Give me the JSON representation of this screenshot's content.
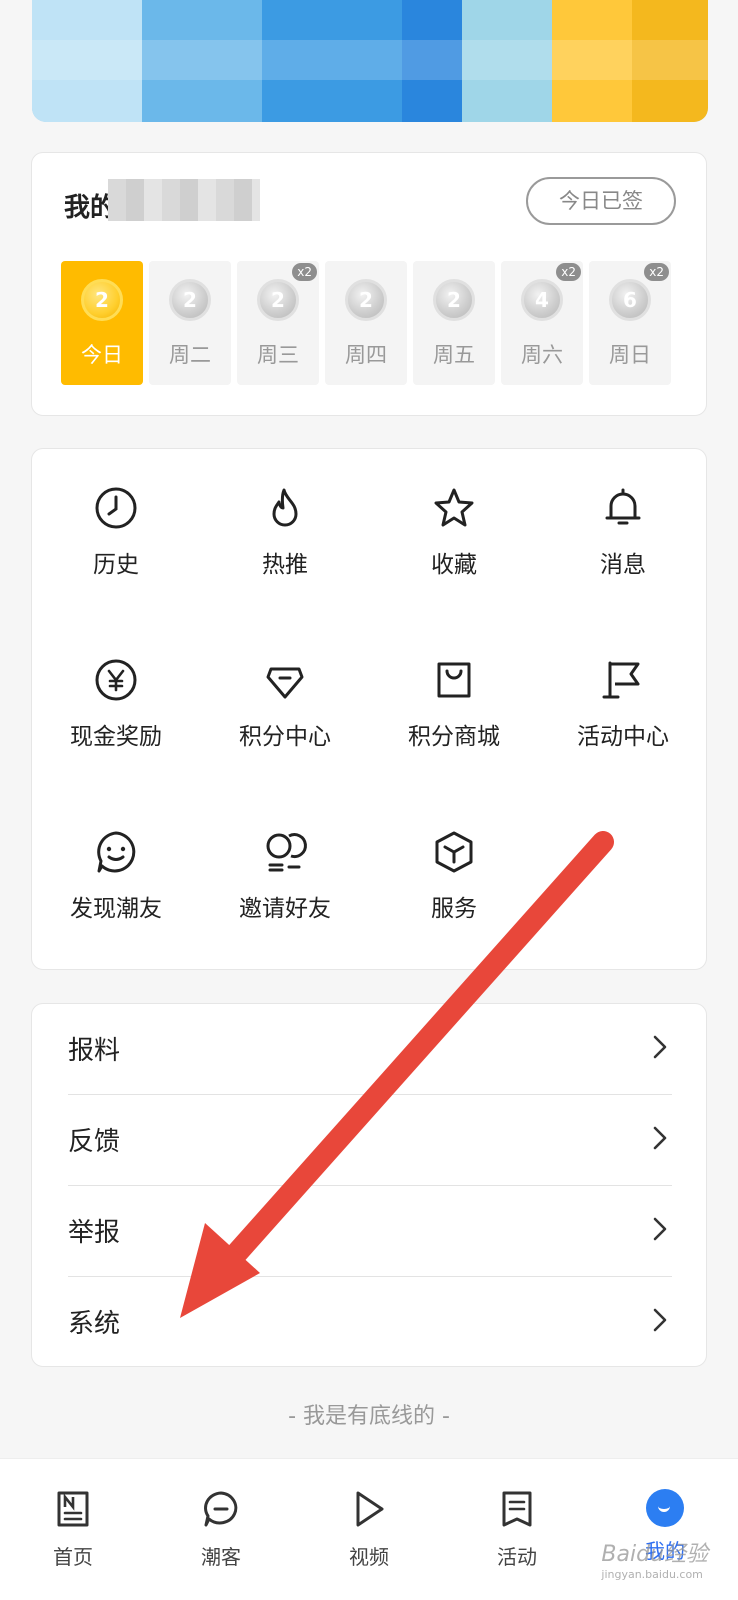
{
  "sign_in": {
    "title": "我的",
    "signed_button": "今日已签",
    "days": [
      {
        "label": "今日",
        "coin": "2",
        "badge": "",
        "today": true
      },
      {
        "label": "周二",
        "coin": "2",
        "badge": ""
      },
      {
        "label": "周三",
        "coin": "2",
        "badge": "x2"
      },
      {
        "label": "周四",
        "coin": "2",
        "badge": ""
      },
      {
        "label": "周五",
        "coin": "2",
        "badge": ""
      },
      {
        "label": "周六",
        "coin": "4",
        "badge": "x2"
      },
      {
        "label": "周日",
        "coin": "6",
        "badge": "x2"
      }
    ]
  },
  "grid": {
    "items": [
      {
        "label": "历史",
        "icon": "clock-icon"
      },
      {
        "label": "热推",
        "icon": "flame-icon"
      },
      {
        "label": "收藏",
        "icon": "star-icon"
      },
      {
        "label": "消息",
        "icon": "bell-icon"
      },
      {
        "label": "现金奖励",
        "icon": "yen-icon"
      },
      {
        "label": "积分中心",
        "icon": "diamond-icon"
      },
      {
        "label": "积分商城",
        "icon": "shopping-bag-icon"
      },
      {
        "label": "活动中心",
        "icon": "flag-icon"
      },
      {
        "label": "发现潮友",
        "icon": "smile-face-icon"
      },
      {
        "label": "邀请好友",
        "icon": "friends-icon"
      },
      {
        "label": "服务",
        "icon": "cube-icon"
      }
    ]
  },
  "list": {
    "rows": [
      {
        "label": "报料"
      },
      {
        "label": "反馈"
      },
      {
        "label": "举报"
      },
      {
        "label": "系统"
      }
    ]
  },
  "footer_note": "- 我是有底线的 -",
  "tabs": [
    {
      "label": "首页",
      "icon": "news-n-icon"
    },
    {
      "label": "潮客",
      "icon": "chat-bubble-icon"
    },
    {
      "label": "视频",
      "icon": "play-icon"
    },
    {
      "label": "活动",
      "icon": "document-icon"
    },
    {
      "label": "我的",
      "icon": "profile-icon",
      "active": true
    }
  ],
  "watermark": {
    "brand": "Baidu经验",
    "domain": "jingyan.baidu.com"
  },
  "colors": {
    "today": "#ffbb00",
    "accent": "#2c7ef2",
    "arrow": "#e8473a"
  }
}
